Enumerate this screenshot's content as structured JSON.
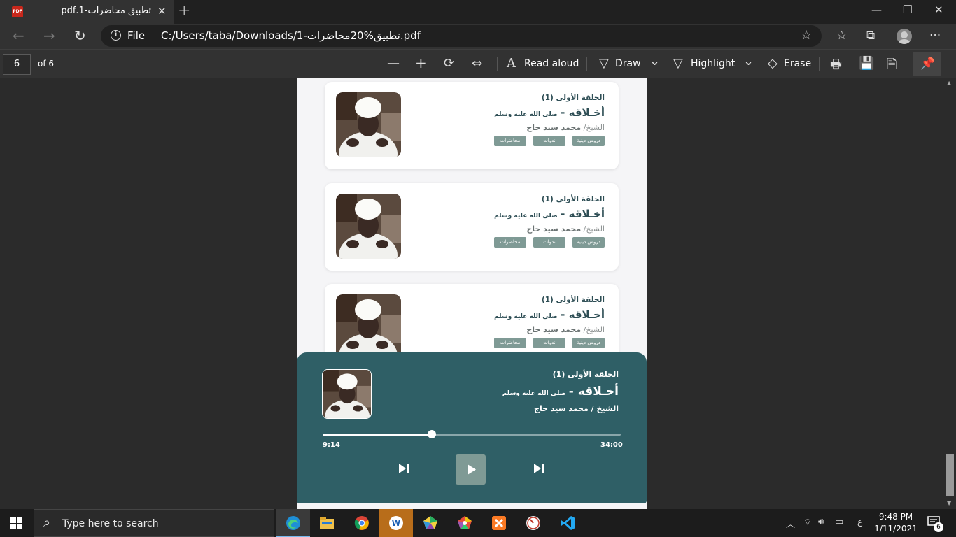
{
  "browser": {
    "tab_title": "تطبيق محاضرات-1.pdf",
    "tab_close": "✕",
    "new_tab": "+",
    "window_controls": {
      "minimize": "—",
      "restore": "❐",
      "close": "✕"
    },
    "address": {
      "info": "i",
      "scheme_label": "File",
      "url": "C:/Users/taba/Downloads/1-تطبيق%20محاضرات.pdf"
    },
    "nav": {
      "back": "←",
      "forward": "→",
      "refresh": "↻"
    },
    "toolbar_icons": {
      "star": "☆",
      "favorites": "☆",
      "collections": "⧉",
      "more": "···"
    }
  },
  "pdf_toolbar": {
    "page_number": "6",
    "page_of": "of 6",
    "zoom_out": "—",
    "zoom_in": "+",
    "rotate": "⟳",
    "fit": "⇔",
    "read_aloud": "Read aloud",
    "draw": "Draw",
    "highlight": "Highlight",
    "erase": "Erase",
    "chevron": "⌄",
    "print": "🖶",
    "save": "💾",
    "save_as": "🗎",
    "pin": "📌"
  },
  "cards": [
    {
      "episode": "الحلقة الأولى (1)",
      "title": "أخـلاقه -",
      "subtitle": "صلى الله عليه وسلم",
      "sheikh_prefix": "الشيخ/",
      "sheikh_name": "محمد سيد حاج",
      "tags": [
        "دروس دينية",
        "ندوات",
        "محاضرات"
      ]
    },
    {
      "episode": "الحلقة الأولى (1)",
      "title": "أخـلاقه -",
      "subtitle": "صلى الله عليه وسلم",
      "sheikh_prefix": "الشيخ/",
      "sheikh_name": "محمد سيد حاج",
      "tags": [
        "دروس دينية",
        "ندوات",
        "محاضرات"
      ]
    },
    {
      "episode": "الحلقة الأولى (1)",
      "title": "أخـلاقه -",
      "subtitle": "صلى الله عليه وسلم",
      "sheikh_prefix": "الشيخ/",
      "sheikh_name": "محمد سيد حاج",
      "tags": [
        "دروس دينية",
        "ندوات",
        "محاضرات"
      ]
    }
  ],
  "player": {
    "episode": "الحلقة الأولى (1)",
    "title": "أخـلاقه -",
    "subtitle": "صلى الله عليه وسلم",
    "sheikh": "الشيخ / محمد سيد حاج",
    "elapsed": "9:14",
    "duration": "34:00",
    "progress_fraction": 0.367,
    "bg_color": "#2f5f66",
    "accent_color": "#7f9a95"
  },
  "taskbar": {
    "search_placeholder": "Type here to search",
    "apps": [
      "edge-icon",
      "file-explorer-icon",
      "chrome-icon",
      "app-w-icon",
      "gem-icon",
      "colorful-gem-icon",
      "xampp-icon",
      "clock-app-icon",
      "vscode-icon"
    ],
    "lang": "ع",
    "time": "9:48 PM",
    "date": "1/11/2021",
    "notification_count": "6"
  }
}
